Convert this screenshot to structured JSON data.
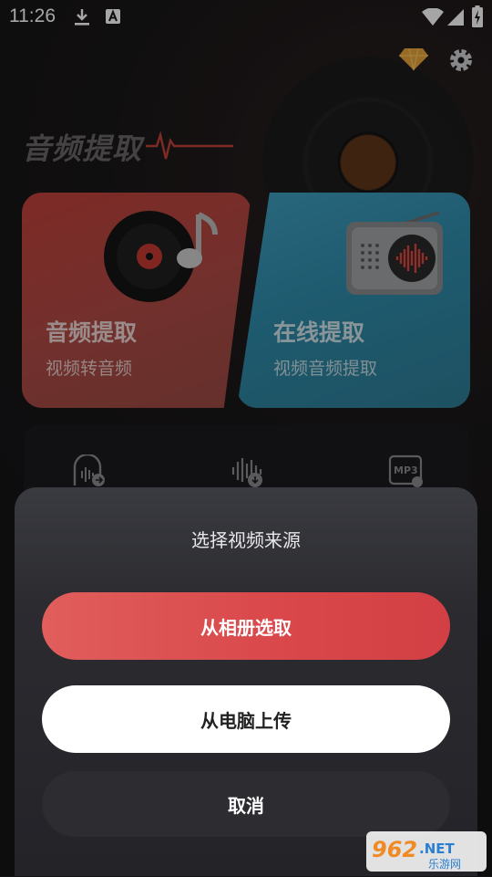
{
  "status_bar": {
    "time": "11:26",
    "icons": [
      "download-icon",
      "a-notification-icon",
      "wifi-icon",
      "signal-icon",
      "battery-charging-icon"
    ]
  },
  "header": {
    "title_art": "音频提取",
    "icons": [
      "diamond-vip-icon",
      "gear-icon"
    ]
  },
  "cards": [
    {
      "title": "音频提取",
      "subtitle": "视频转音频",
      "icon": "vinyl-music-icon",
      "color": "#c2413a"
    },
    {
      "title": "在线提取",
      "subtitle": "视频音频提取",
      "icon": "radio-icon",
      "color": "#3f9fc0"
    }
  ],
  "tools": {
    "icons": [
      "audio-export-icon",
      "waveform-download-icon",
      "mp3-convert-icon"
    ]
  },
  "sheet": {
    "title": "选择视频来源",
    "primary_label": "从相册选取",
    "secondary_label": "从电脑上传",
    "cancel_label": "取消"
  },
  "watermark": {
    "brand": "962.NET",
    "sub": "乐游网"
  },
  "colors": {
    "accent": "#dc4a4c",
    "sheet_bg": "#2b2b30",
    "background": "#141416"
  }
}
